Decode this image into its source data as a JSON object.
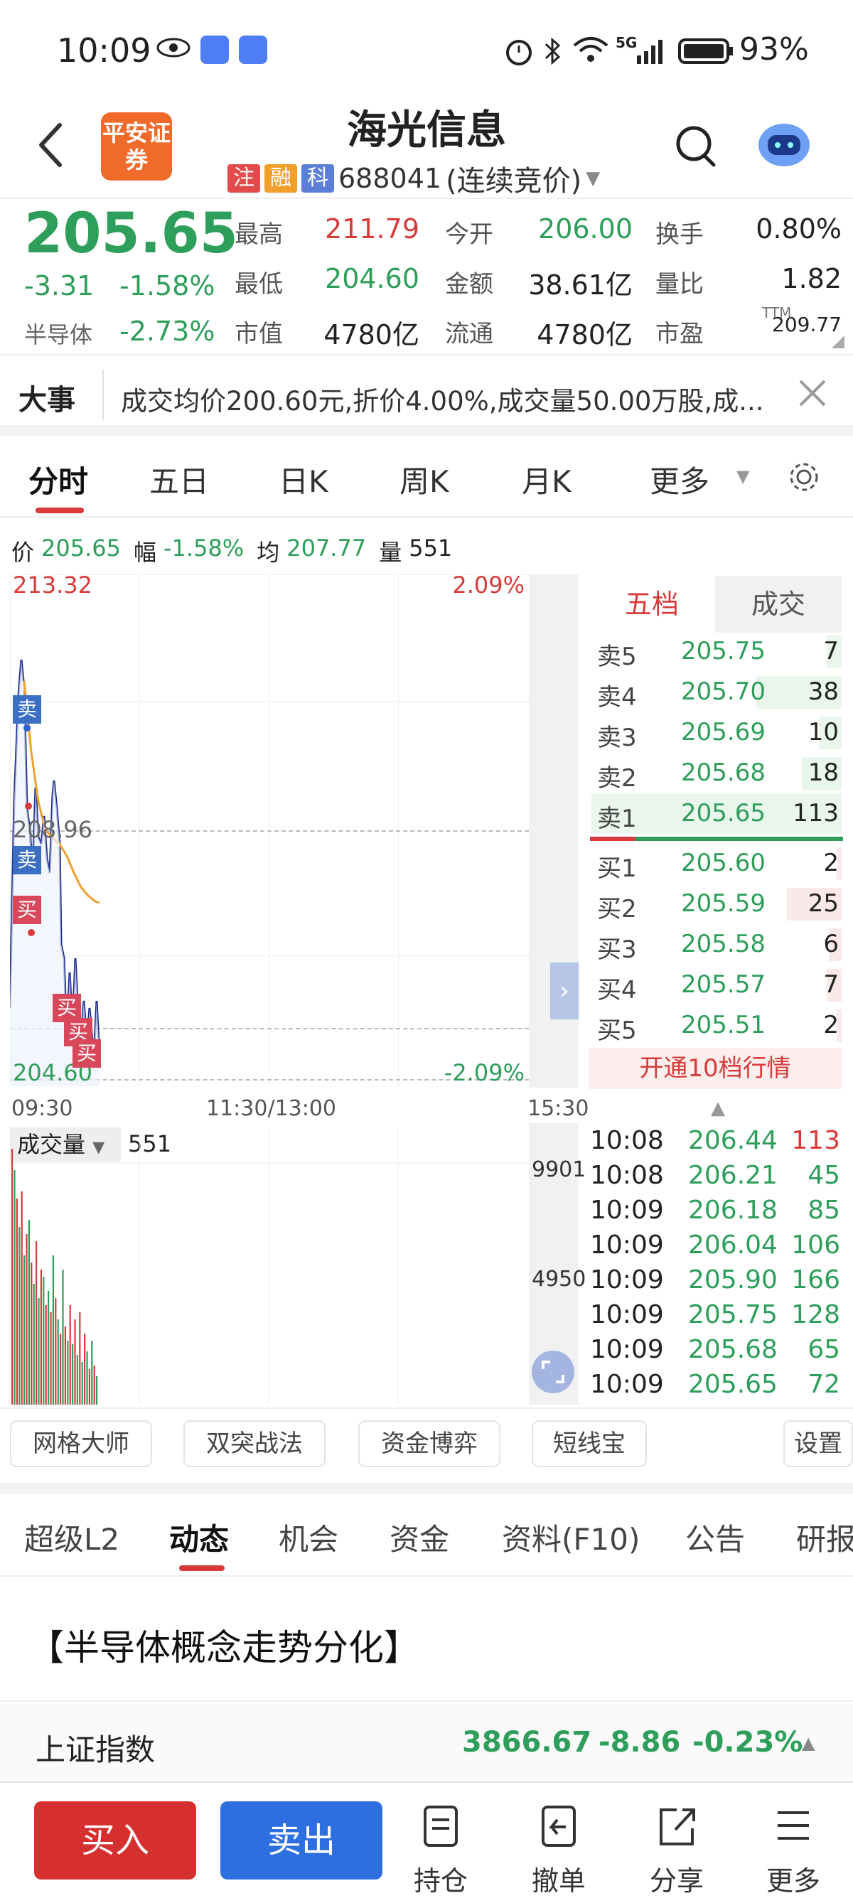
{
  "status_bar": {
    "time": "10:09",
    "network": "5G",
    "battery": "93%"
  },
  "header": {
    "broker_logo": "平安证券",
    "stock_name": "海光信息",
    "tags": [
      "注",
      "融",
      "科"
    ],
    "code": "688041",
    "trade_mode": "(连续竞价)"
  },
  "quote": {
    "price": "205.65",
    "change": "-3.31",
    "change_pct": "-1.58%",
    "sector": "半导体",
    "sector_pct": "-2.73%",
    "grid": [
      {
        "label": "最高",
        "value": "211.79",
        "color": "red"
      },
      {
        "label": "今开",
        "value": "206.00",
        "color": "green"
      },
      {
        "label": "换手",
        "value": "0.80%",
        "color": "black"
      },
      {
        "label": "最低",
        "value": "204.60",
        "color": "green"
      },
      {
        "label": "金额",
        "value": "38.61亿",
        "color": "black"
      },
      {
        "label": "量比",
        "value": "1.82",
        "color": "black"
      },
      {
        "label": "市值",
        "value": "4780亿",
        "color": "black"
      },
      {
        "label": "流通",
        "value": "4780亿",
        "color": "black"
      },
      {
        "label": "市盈",
        "value": "209.77",
        "color": "black"
      }
    ],
    "pe_suffix": "TTM"
  },
  "news": {
    "label": "大事",
    "text": "成交均价200.60元,折价4.00%,成交量50.00万股,成..."
  },
  "chart_tabs": [
    "分时",
    "五日",
    "日K",
    "周K",
    "月K",
    "更多"
  ],
  "chart_info": {
    "price_label": "价",
    "price": "205.65",
    "pct_label": "幅",
    "pct": "-1.58%",
    "avg_label": "均",
    "avg": "207.77",
    "vol_label": "量",
    "vol": "551"
  },
  "intraday": {
    "y_top": "213.32",
    "y_mid": "208.96",
    "y_bottom": "204.60",
    "pct_top": "2.09%",
    "pct_bottom": "-2.09%",
    "x_start": "09:30",
    "x_mid": "11:30/13:00",
    "x_end": "15:30",
    "markers": [
      "卖",
      "卖",
      "买",
      "买",
      "买",
      "买"
    ]
  },
  "volume": {
    "label": "成交量",
    "value": "551",
    "axis_top": "9901",
    "axis_mid": "4950"
  },
  "order_book": {
    "tabs": [
      "五档",
      "成交"
    ],
    "asks": [
      {
        "label": "卖5",
        "price": "205.75",
        "qty": "7",
        "bar": 0.06
      },
      {
        "label": "卖4",
        "price": "205.70",
        "qty": "38",
        "bar": 0.34
      },
      {
        "label": "卖3",
        "price": "205.69",
        "qty": "10",
        "bar": 0.09
      },
      {
        "label": "卖2",
        "price": "205.68",
        "qty": "18",
        "bar": 0.16
      },
      {
        "label": "卖1",
        "price": "205.65",
        "qty": "113",
        "bar": 1.0
      }
    ],
    "bids": [
      {
        "label": "买1",
        "price": "205.60",
        "qty": "2",
        "bar": 0.02
      },
      {
        "label": "买2",
        "price": "205.59",
        "qty": "25",
        "bar": 0.22
      },
      {
        "label": "买3",
        "price": "205.58",
        "qty": "6",
        "bar": 0.05
      },
      {
        "label": "买4",
        "price": "205.57",
        "qty": "7",
        "bar": 0.06
      },
      {
        "label": "买5",
        "price": "205.51",
        "qty": "2",
        "bar": 0.02
      }
    ],
    "upgrade_label": "开通10档行情"
  },
  "trades": [
    {
      "time": "10:08",
      "price": "206.44",
      "qty": "113",
      "color": "red"
    },
    {
      "time": "10:08",
      "price": "206.21",
      "qty": "45",
      "color": "green"
    },
    {
      "time": "10:09",
      "price": "206.18",
      "qty": "85",
      "color": "green"
    },
    {
      "time": "10:09",
      "price": "206.04",
      "qty": "106",
      "color": "green"
    },
    {
      "time": "10:09",
      "price": "205.90",
      "qty": "166",
      "color": "green"
    },
    {
      "time": "10:09",
      "price": "205.75",
      "qty": "128",
      "color": "green"
    },
    {
      "time": "10:09",
      "price": "205.68",
      "qty": "65",
      "color": "green"
    },
    {
      "time": "10:09",
      "price": "205.65",
      "qty": "72",
      "color": "green"
    }
  ],
  "tools": [
    "网格大师",
    "双突战法",
    "资金博弈",
    "短线宝",
    "设置"
  ],
  "section_tabs": [
    "超级L2",
    "动态",
    "机会",
    "资金",
    "资料(F10)",
    "公告",
    "研报"
  ],
  "headline": "【半导体概念走势分化】",
  "index": {
    "name": "上证指数",
    "value": "3866.67",
    "change": "-8.86",
    "pct": "-0.23%"
  },
  "bottom_nav": {
    "buy": "买入",
    "sell": "卖出",
    "items": [
      {
        "label": "持仓",
        "icon": "document-icon"
      },
      {
        "label": "撤单",
        "icon": "undo-icon"
      },
      {
        "label": "分享",
        "icon": "share-icon"
      },
      {
        "label": "更多",
        "icon": "menu-icon"
      }
    ]
  },
  "colors": {
    "up": "#d83a3a",
    "down": "#2e9e5b",
    "brand": "#f06a2a",
    "sell_button": "#2e6fe0",
    "buy_button": "#d62f2f"
  }
}
